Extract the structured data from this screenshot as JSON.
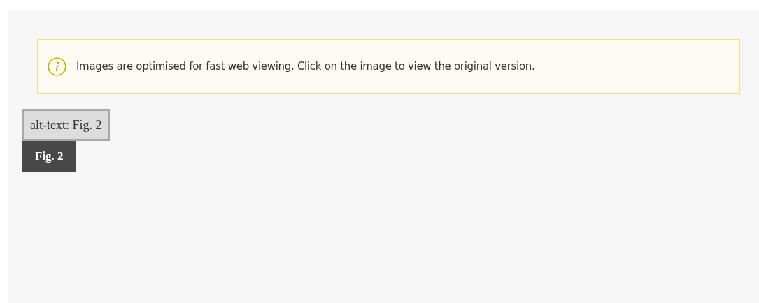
{
  "notice": {
    "text": "Images are optimised for fast web viewing. Click on the image to view the original version."
  },
  "figure": {
    "alt_text": "alt-text: Fig. 2",
    "caption": "Fig. 2"
  }
}
